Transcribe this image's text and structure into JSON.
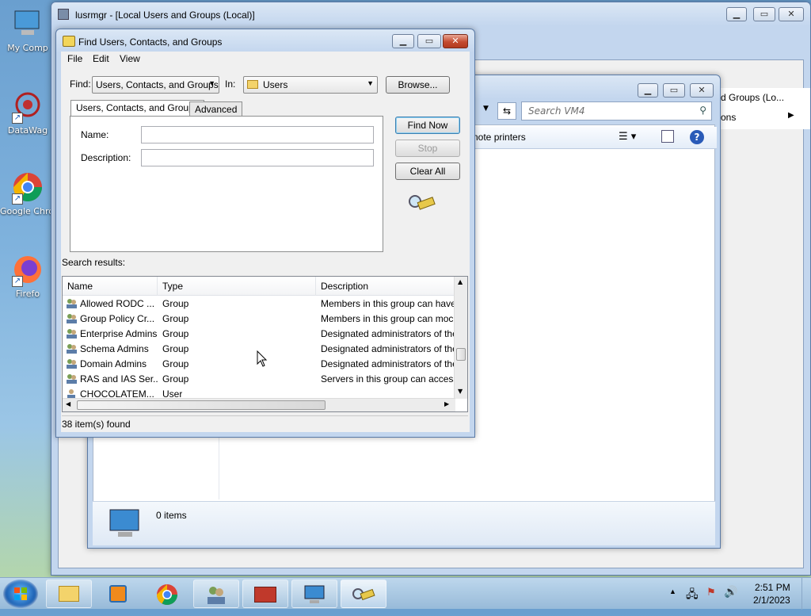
{
  "desktop": {
    "icons": [
      {
        "label": "My Comp",
        "icon": "computer-icon"
      },
      {
        "label": "DataWag",
        "icon": "datawag-icon"
      },
      {
        "label": "Google Chrom",
        "icon": "chrome-icon"
      },
      {
        "label": "Firefo",
        "icon": "firefox-icon"
      }
    ]
  },
  "lusrmgr": {
    "title": "lusrmgr - [Local Users and Groups (Local)]",
    "side_text": "d Groups (Lo...",
    "side_text2": "ons"
  },
  "explorer": {
    "search_placeholder": "Search VM4",
    "cmd_label": "note printers",
    "status_count": "0 items"
  },
  "find_dialog": {
    "title": "Find Users, Contacts, and Groups",
    "menu": [
      "File",
      "Edit",
      "View"
    ],
    "find_label": "Find:",
    "find_value": "Users, Contacts, and Groups",
    "in_label": "In:",
    "in_value": "Users",
    "browse_label": "Browse...",
    "tabs": [
      "Users, Contacts, and Groups",
      "Advanced"
    ],
    "name_label": "Name:",
    "description_label": "Description:",
    "name_value": "",
    "description_value": "",
    "find_now_label": "Find Now",
    "stop_label": "Stop",
    "clear_all_label": "Clear All",
    "results_label": "Search results:",
    "columns": [
      "Name",
      "Type",
      "Description"
    ],
    "rows": [
      {
        "name": "Allowed RODC ...",
        "type": "Group",
        "description": "Members in this group can have"
      },
      {
        "name": "Group Policy Cr...",
        "type": "Group",
        "description": "Members in this group can moc"
      },
      {
        "name": "Enterprise Admins",
        "type": "Group",
        "description": "Designated administrators of the"
      },
      {
        "name": "Schema Admins",
        "type": "Group",
        "description": "Designated administrators of the"
      },
      {
        "name": "Domain Admins",
        "type": "Group",
        "description": "Designated administrators of the"
      },
      {
        "name": "RAS and IAS Ser...",
        "type": "Group",
        "description": "Servers in this group can access"
      },
      {
        "name": "CHOCOLATEM...",
        "type": "User",
        "description": ""
      }
    ],
    "status": "38 item(s) found"
  },
  "taskbar": {
    "time": "2:51 PM",
    "date": "2/1/2023"
  }
}
